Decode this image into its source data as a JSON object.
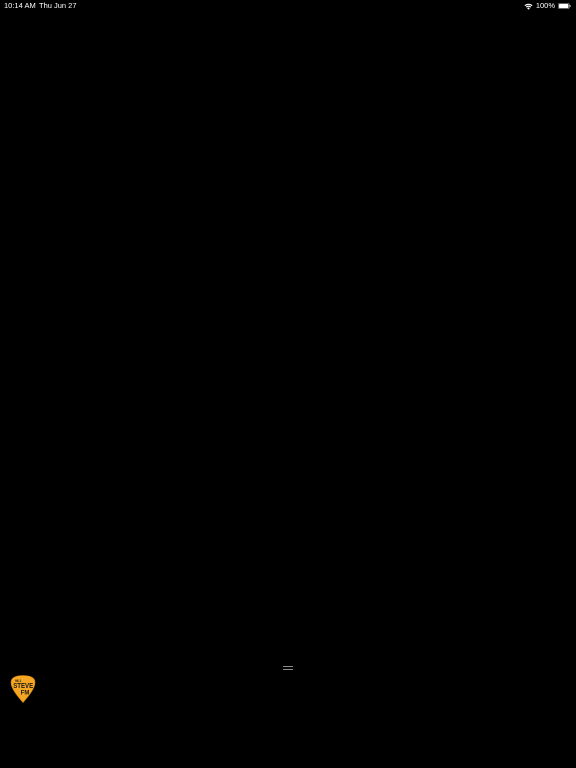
{
  "status_bar": {
    "time": "10:14 AM",
    "date": "Thu Jun 27",
    "battery_percent": "100%",
    "wifi_icon": "wifi-icon",
    "battery_icon": "battery-full-icon"
  },
  "mini_player": {
    "handle_icon": "drag-handle-icon",
    "station_logo": {
      "frequency": "96.1",
      "line1": "STEVE",
      "line2": "FM",
      "color": "#F5A623"
    }
  },
  "colors": {
    "background": "#000000",
    "text": "#FFFFFF",
    "logo_accent": "#F5A623"
  }
}
